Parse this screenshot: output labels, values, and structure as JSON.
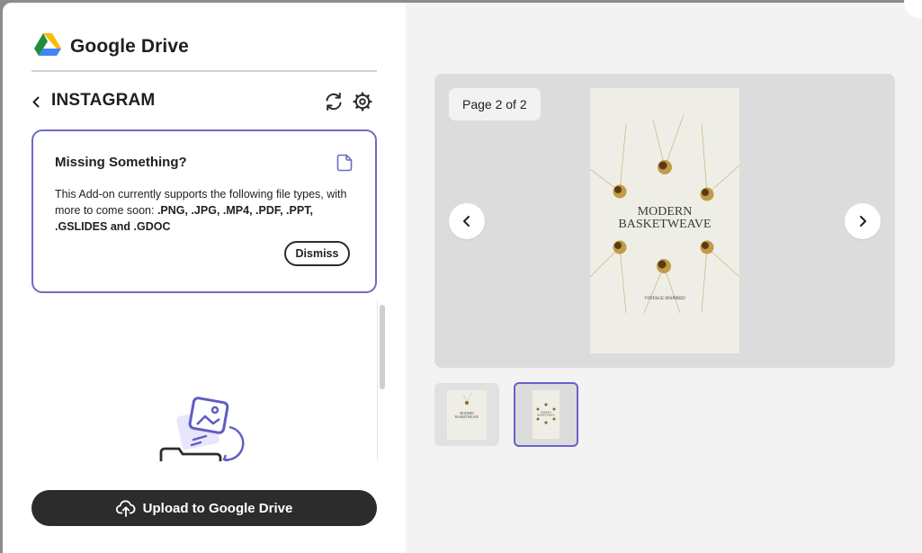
{
  "header": {
    "app_title": "Google Drive",
    "icon": "google-drive-icon"
  },
  "nav": {
    "back_icon": "chevron-left-icon",
    "section_title": "INSTAGRAM",
    "refresh_icon": "refresh-icon",
    "settings_icon": "gear-icon"
  },
  "notice": {
    "title": "Missing Something?",
    "icon": "document-icon",
    "text_intro": "This Add-on currently supports the following file types, with more to come soon: ",
    "file_types": ".PNG, .JPG, .MP4, .PDF, .PPT, .GSLIDES and .GDOC",
    "dismiss_label": "Dismiss"
  },
  "upload": {
    "label": "Upload to Google Drive",
    "icon": "cloud-upload-icon"
  },
  "preview": {
    "page_indicator": "Page 2 of 2",
    "image_title_line1": "MODERN",
    "image_title_line2": "BASKETWEAVE",
    "image_subtitle": "VINTAGE INSPIRED",
    "prev_icon": "chevron-left-icon",
    "next_icon": "chevron-right-icon"
  },
  "thumbnails": [
    {
      "line1": "MODERN",
      "line2": "BASKETWEAVE",
      "selected": false
    },
    {
      "line1": "MODERN",
      "line2": "BASKETWEAVE",
      "selected": true
    }
  ],
  "colors": {
    "accent": "#6c6bc6",
    "button_dark": "#2c2c2c",
    "preview_bg": "#dcdcdc",
    "panel_right_bg": "#f3f3f3"
  }
}
